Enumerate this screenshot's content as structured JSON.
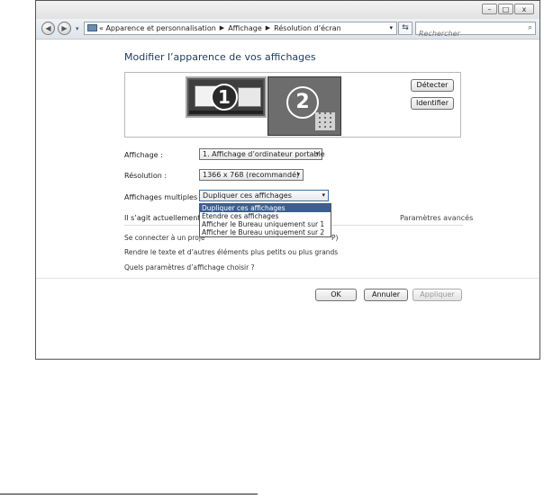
{
  "window": {
    "controls": {
      "minimize": "–",
      "maximize": "□",
      "close": "x"
    }
  },
  "toolbar": {
    "back": "◀",
    "forward": "▶",
    "nav_dropdown": "▾",
    "breadcrumb_prefix": "«",
    "breadcrumbs": [
      "Apparence et personnalisation",
      "Affichage",
      "Résolution d’écran"
    ],
    "separator": "▶",
    "address_dropdown": "▾",
    "refresh": "⇆",
    "search_placeholder": "Rechercher",
    "search_icon": "⌕"
  },
  "main": {
    "heading": "Modifier l’apparence de vos affichages",
    "monitor1_number": "1",
    "monitor2_number": "2",
    "detect_button": "Détecter",
    "identify_button": "Identifier",
    "display_label": "Affichage :",
    "display_value": "1. Affichage d’ordinateur portable",
    "resolution_label": "Résolution :",
    "resolution_value": "1366 x 768 (recommandé)",
    "multiple_label": "Affichages multiples :",
    "multiple_value": "Dupliquer ces affichages",
    "caret": "▾",
    "options": [
      "Dupliquer ces affichages",
      "Étendre ces affichages",
      "Afficher le Bureau uniquement sur 1",
      "Afficher le Bureau uniquement sur 2"
    ],
    "status_text": "Il s’agit actuellement de",
    "advanced_link": "Paramètres avancés",
    "links": [
      "Se connecter à un proje",
      "Rendre le texte et d’autres éléments plus petits ou plus grands",
      "Quels paramètres d’affichage choisir ?"
    ],
    "link1_suffix": "P)",
    "ok_button": "OK",
    "cancel_button": "Annuler",
    "apply_button": "Appliquer"
  }
}
